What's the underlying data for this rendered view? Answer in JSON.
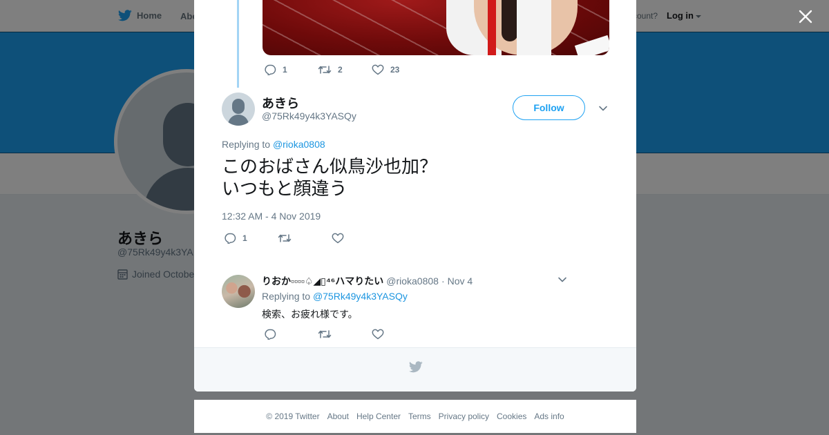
{
  "nav": {
    "home": "Home",
    "about": "Abo",
    "account_prompt": "ccount?",
    "login": "Log in"
  },
  "background_profile": {
    "name": "あきら",
    "handle": "@75Rk49y4k3YA",
    "joined": "Joined Octobe"
  },
  "previous_tweet": {
    "reply_count": "1",
    "retweet_count": "2",
    "like_count": "23"
  },
  "main_tweet": {
    "author_name": "あきら",
    "author_handle": "@75Rk49y4k3YASQy",
    "follow_label": "Follow",
    "replying_prefix": "Replying to ",
    "replying_to": "@rioka0808",
    "text": "このおばさん似鳥沙也加？\nいつもと顔違う",
    "timestamp": "12:32 AM - 4 Nov 2019",
    "reply_count": "1",
    "retweet_count": "",
    "like_count": ""
  },
  "reply_tweet": {
    "author_name": "りおか▫▫▫▫♤◢▯⁴⁶ハマりたい",
    "author_handle": "@rioka0808",
    "separator": "·",
    "date": "Nov 4",
    "replying_prefix": "Replying to ",
    "replying_to": "@75Rk49y4k3YASQy",
    "text": "検索、お疲れ様です。"
  },
  "footer": {
    "links": [
      "© 2019 Twitter",
      "About",
      "Help Center",
      "Terms",
      "Privacy policy",
      "Cookies",
      "Ads info"
    ]
  },
  "colors": {
    "brand": "#1da1f2",
    "link": "#1b95e0",
    "muted": "#657786"
  },
  "icons": {
    "close": "close-icon",
    "reply": "reply-icon",
    "retweet": "retweet-icon",
    "like": "heart-icon",
    "bird": "twitter-bird-icon",
    "chevron": "chevron-down-icon",
    "calendar": "calendar-icon"
  }
}
